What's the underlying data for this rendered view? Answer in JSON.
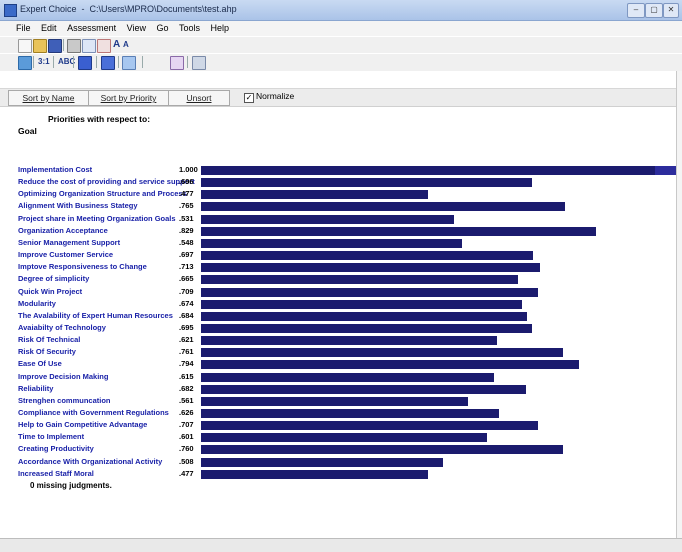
{
  "window": {
    "app_name": "Expert Choice",
    "file_path": "C:\\Users\\MPRO\\Documents\\test.ahp",
    "controls": [
      "–",
      "▢",
      "✕"
    ]
  },
  "menu": [
    "File",
    "Edit",
    "Assessment",
    "View",
    "Go",
    "Tools",
    "Help"
  ],
  "toolbar2_labels": [
    "3:1",
    "ABC"
  ],
  "sortbar": {
    "sort_by_name": "Sort by Name",
    "sort_by_priority": "Sort by Priority",
    "unsort": "Unsort",
    "normalize": "Normalize",
    "normalize_checked": true
  },
  "heading": "Priorities with respect to:",
  "goal": "Goal",
  "criteria": [
    {
      "name": "Implementation Cost",
      "value": "1.000",
      "priority": 1.0
    },
    {
      "name": "Reduce the cost of providing and service support",
      "value": ".696",
      "priority": 0.696
    },
    {
      "name": "Optimizing Organization Structure and Process",
      "value": ".477",
      "priority": 0.477
    },
    {
      "name": "Alignment With Business Stategy",
      "value": ".765",
      "priority": 0.765
    },
    {
      "name": "Project share in Meeting Organization Goals",
      "value": ".531",
      "priority": 0.531
    },
    {
      "name": "Organization Acceptance",
      "value": ".829",
      "priority": 0.829
    },
    {
      "name": "Senior Management Support",
      "value": ".548",
      "priority": 0.548
    },
    {
      "name": "Improve Customer Service",
      "value": ".697",
      "priority": 0.697
    },
    {
      "name": "Imptove Responsiveness to Change",
      "value": ".713",
      "priority": 0.713
    },
    {
      "name": "Degree of simplicity",
      "value": ".665",
      "priority": 0.665
    },
    {
      "name": "Quick Win Project",
      "value": ".709",
      "priority": 0.709
    },
    {
      "name": "Modularity",
      "value": ".674",
      "priority": 0.674
    },
    {
      "name": "The Avalability of Expert Human Resources",
      "value": ".684",
      "priority": 0.684
    },
    {
      "name": "Avaiabilty of Technology",
      "value": ".695",
      "priority": 0.695
    },
    {
      "name": "Risk Of Technical",
      "value": ".621",
      "priority": 0.621
    },
    {
      "name": "Risk Of Security",
      "value": ".761",
      "priority": 0.761
    },
    {
      "name": "Ease Of Use",
      "value": ".794",
      "priority": 0.794
    },
    {
      "name": "Improve Decision Making",
      "value": ".615",
      "priority": 0.615
    },
    {
      "name": "Reliability",
      "value": ".682",
      "priority": 0.682
    },
    {
      "name": "Strenghen communcation",
      "value": ".561",
      "priority": 0.561
    },
    {
      "name": "Compliance with Government Regulations",
      "value": ".626",
      "priority": 0.626
    },
    {
      "name": "Help to Gain Competitive Advantage",
      "value": ".707",
      "priority": 0.707
    },
    {
      "name": "Time to Implement",
      "value": ".601",
      "priority": 0.601
    },
    {
      "name": "Creating Productivity",
      "value": ".760",
      "priority": 0.76
    },
    {
      "name": "Accordance With Organizational Activity",
      "value": ".508",
      "priority": 0.508
    },
    {
      "name": "Increased Staff Moral",
      "value": ".477",
      "priority": 0.477
    }
  ],
  "missing_judgments": "0 missing judgments.",
  "colors": {
    "bar": "#1b1b6e",
    "label": "#1a22a8"
  }
}
